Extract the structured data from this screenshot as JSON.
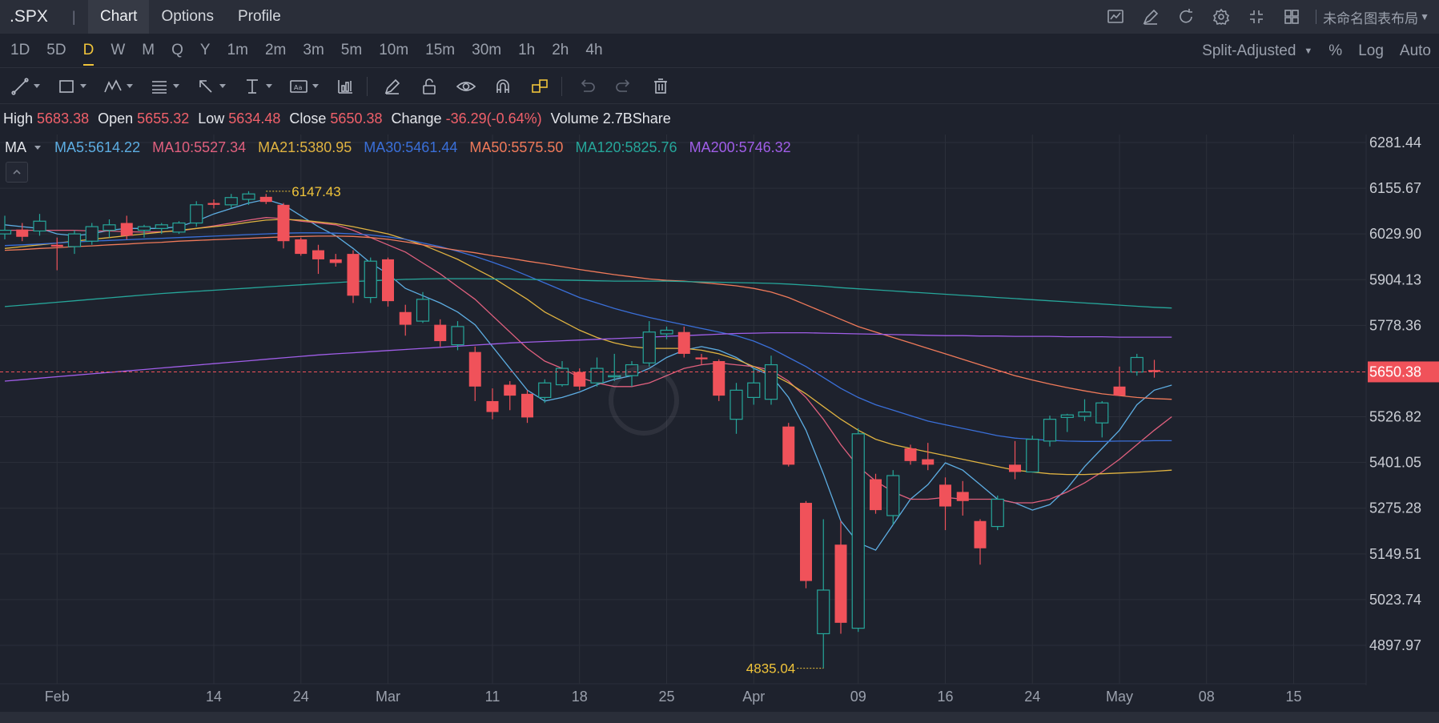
{
  "topbar": {
    "symbol": ".SPX",
    "tabs": [
      {
        "label": "Chart",
        "active": true
      },
      {
        "label": "Options",
        "active": false
      },
      {
        "label": "Profile",
        "active": false
      }
    ],
    "icons": [
      "chart-icon",
      "draw-icon",
      "refresh-icon",
      "settings-icon",
      "fullscreen-icon",
      "layout-grid-icon"
    ],
    "layout_name": "未命名图表布局"
  },
  "intervals": [
    {
      "label": "1D",
      "active": false
    },
    {
      "label": "5D",
      "active": false
    },
    {
      "label": "D",
      "active": true
    },
    {
      "label": "W",
      "active": false
    },
    {
      "label": "M",
      "active": false
    },
    {
      "label": "Q",
      "active": false
    },
    {
      "label": "Y",
      "active": false
    },
    {
      "label": "1m",
      "active": false
    },
    {
      "label": "2m",
      "active": false
    },
    {
      "label": "3m",
      "active": false
    },
    {
      "label": "5m",
      "active": false
    },
    {
      "label": "10m",
      "active": false
    },
    {
      "label": "15m",
      "active": false
    },
    {
      "label": "30m",
      "active": false
    },
    {
      "label": "1h",
      "active": false
    },
    {
      "label": "2h",
      "active": false
    },
    {
      "label": "4h",
      "active": false
    }
  ],
  "interval_right": {
    "adjust": "Split-Adjusted",
    "percent": "%",
    "log": "Log",
    "auto": "Auto"
  },
  "toolbar": {
    "tools": [
      "trendline-icon",
      "rectangle-icon",
      "pattern-icon",
      "fibonacci-icon",
      "arrow-icon",
      "measure-icon",
      "text-icon",
      "indicator-icon"
    ],
    "actions": [
      "pencil-icon",
      "lock-icon",
      "eye-icon",
      "magnet-icon",
      "link-icon",
      "undo-icon",
      "redo-icon",
      "trash-icon"
    ]
  },
  "ohlc": {
    "high_label": "High",
    "high": "5683.38",
    "open_label": "Open",
    "open": "5655.32",
    "low_label": "Low",
    "low": "5634.48",
    "close_label": "Close",
    "close": "5650.38",
    "change_label": "Change",
    "change": "-36.29(-0.64%)",
    "volume_label": "Volume",
    "volume": "2.7BShare"
  },
  "ma_indicator": {
    "label": "MA",
    "items": [
      {
        "text": "MA5:5614.22",
        "color": "#5dade2"
      },
      {
        "text": "MA10:5527.34",
        "color": "#e0607e"
      },
      {
        "text": "MA21:5380.95",
        "color": "#e0b341"
      },
      {
        "text": "MA30:5461.44",
        "color": "#3a6fd8"
      },
      {
        "text": "MA50:5575.50",
        "color": "#f07a5a"
      },
      {
        "text": "MA120:5825.76",
        "color": "#26a69a"
      },
      {
        "text": "MA200:5746.32",
        "color": "#a05ee8"
      }
    ]
  },
  "chart_data": {
    "type": "candlestick",
    "y_ticks": [
      "6281.44",
      "6155.67",
      "6029.90",
      "5904.13",
      "5778.36",
      "5650.38",
      "5526.82",
      "5401.05",
      "5275.28",
      "5149.51",
      "5023.74",
      "4897.97"
    ],
    "ylim": [
      4835.04,
      6281.44
    ],
    "current_price": "5650.38",
    "x_ticks": [
      {
        "label": "Feb",
        "index": 3
      },
      {
        "label": "14",
        "index": 12
      },
      {
        "label": "24",
        "index": 17
      },
      {
        "label": "Mar",
        "index": 22
      },
      {
        "label": "11",
        "index": 28
      },
      {
        "label": "18",
        "index": 33
      },
      {
        "label": "25",
        "index": 38
      },
      {
        "label": "Apr",
        "index": 43
      },
      {
        "label": "09",
        "index": 49
      },
      {
        "label": "16",
        "index": 54
      },
      {
        "label": "24",
        "index": 59
      },
      {
        "label": "May",
        "index": 64
      },
      {
        "label": "08",
        "index": 69
      },
      {
        "label": "15",
        "index": 74
      }
    ],
    "annotations": [
      {
        "text": "6147.43",
        "index": 15,
        "value": 6147.43
      },
      {
        "text": "4835.04",
        "index": 47,
        "value": 4835.04
      }
    ],
    "candles": [
      {
        "o": 6030,
        "h": 6080,
        "l": 6015,
        "c": 6040
      },
      {
        "o": 6042,
        "h": 6060,
        "l": 6010,
        "c": 6022
      },
      {
        "o": 6038,
        "h": 6085,
        "l": 6025,
        "c": 6065
      },
      {
        "o": 6000,
        "h": 6020,
        "l": 5930,
        "c": 5995
      },
      {
        "o": 5995,
        "h": 6040,
        "l": 5975,
        "c": 6030
      },
      {
        "o": 6010,
        "h": 6060,
        "l": 6000,
        "c": 6050
      },
      {
        "o": 6040,
        "h": 6070,
        "l": 6020,
        "c": 6055
      },
      {
        "o": 6060,
        "h": 6080,
        "l": 6015,
        "c": 6025
      },
      {
        "o": 6040,
        "h": 6055,
        "l": 6020,
        "c": 6050
      },
      {
        "o": 6045,
        "h": 6060,
        "l": 6030,
        "c": 6055
      },
      {
        "o": 6035,
        "h": 6065,
        "l": 6030,
        "c": 6060
      },
      {
        "o": 6060,
        "h": 6120,
        "l": 6050,
        "c": 6110
      },
      {
        "o": 6115,
        "h": 6125,
        "l": 6100,
        "c": 6110
      },
      {
        "o": 6110,
        "h": 6140,
        "l": 6100,
        "c": 6130
      },
      {
        "o": 6125,
        "h": 6147.43,
        "l": 6110,
        "c": 6140
      },
      {
        "o": 6132,
        "h": 6140,
        "l": 6112,
        "c": 6118
      },
      {
        "o": 6110,
        "h": 6115,
        "l": 5990,
        "c": 6010
      },
      {
        "o": 6015,
        "h": 6020,
        "l": 5970,
        "c": 5975
      },
      {
        "o": 5985,
        "h": 6000,
        "l": 5920,
        "c": 5960
      },
      {
        "o": 5960,
        "h": 5975,
        "l": 5940,
        "c": 5950
      },
      {
        "o": 5975,
        "h": 5985,
        "l": 5840,
        "c": 5860
      },
      {
        "o": 5855,
        "h": 5965,
        "l": 5840,
        "c": 5955
      },
      {
        "o": 5960,
        "h": 5965,
        "l": 5830,
        "c": 5845
      },
      {
        "o": 5815,
        "h": 5835,
        "l": 5750,
        "c": 5780
      },
      {
        "o": 5790,
        "h": 5870,
        "l": 5785,
        "c": 5850
      },
      {
        "o": 5780,
        "h": 5795,
        "l": 5720,
        "c": 5735
      },
      {
        "o": 5725,
        "h": 5790,
        "l": 5710,
        "c": 5775
      },
      {
        "o": 5705,
        "h": 5720,
        "l": 5570,
        "c": 5610
      },
      {
        "o": 5570,
        "h": 5605,
        "l": 5520,
        "c": 5540
      },
      {
        "o": 5615,
        "h": 5625,
        "l": 5545,
        "c": 5585
      },
      {
        "o": 5590,
        "h": 5600,
        "l": 5510,
        "c": 5525
      },
      {
        "o": 5580,
        "h": 5630,
        "l": 5565,
        "c": 5620
      },
      {
        "o": 5615,
        "h": 5680,
        "l": 5610,
        "c": 5660
      },
      {
        "o": 5650,
        "h": 5660,
        "l": 5600,
        "c": 5610
      },
      {
        "o": 5620,
        "h": 5690,
        "l": 5610,
        "c": 5660
      },
      {
        "o": 5640,
        "h": 5700,
        "l": 5625,
        "c": 5640
      },
      {
        "o": 5640,
        "h": 5680,
        "l": 5610,
        "c": 5670
      },
      {
        "o": 5675,
        "h": 5790,
        "l": 5665,
        "c": 5760
      },
      {
        "o": 5755,
        "h": 5775,
        "l": 5740,
        "c": 5765
      },
      {
        "o": 5760,
        "h": 5775,
        "l": 5690,
        "c": 5700
      },
      {
        "o": 5690,
        "h": 5700,
        "l": 5670,
        "c": 5685
      },
      {
        "o": 5680,
        "h": 5685,
        "l": 5570,
        "c": 5585
      },
      {
        "o": 5520,
        "h": 5620,
        "l": 5480,
        "c": 5600
      },
      {
        "o": 5580,
        "h": 5660,
        "l": 5560,
        "c": 5620
      },
      {
        "o": 5575,
        "h": 5695,
        "l": 5560,
        "c": 5670
      },
      {
        "o": 5500,
        "h": 5510,
        "l": 5390,
        "c": 5395
      },
      {
        "o": 5290,
        "h": 5295,
        "l": 5055,
        "c": 5075
      },
      {
        "o": 4930,
        "h": 5245,
        "l": 4835.04,
        "c": 5050
      },
      {
        "o": 5175,
        "h": 5240,
        "l": 4930,
        "c": 4960
      },
      {
        "o": 4945,
        "h": 5495,
        "l": 4935,
        "c": 5480
      },
      {
        "o": 5355,
        "h": 5370,
        "l": 5260,
        "c": 5270
      },
      {
        "o": 5255,
        "h": 5380,
        "l": 5230,
        "c": 5365
      },
      {
        "o": 5440,
        "h": 5450,
        "l": 5395,
        "c": 5405
      },
      {
        "o": 5410,
        "h": 5455,
        "l": 5380,
        "c": 5395
      },
      {
        "o": 5340,
        "h": 5360,
        "l": 5215,
        "c": 5280
      },
      {
        "o": 5320,
        "h": 5350,
        "l": 5255,
        "c": 5295
      },
      {
        "o": 5240,
        "h": 5245,
        "l": 5120,
        "c": 5165
      },
      {
        "o": 5225,
        "h": 5310,
        "l": 5215,
        "c": 5300
      },
      {
        "o": 5395,
        "h": 5460,
        "l": 5355,
        "c": 5375
      },
      {
        "o": 5375,
        "h": 5475,
        "l": 5375,
        "c": 5465
      },
      {
        "o": 5460,
        "h": 5530,
        "l": 5445,
        "c": 5520
      },
      {
        "o": 5525,
        "h": 5535,
        "l": 5485,
        "c": 5532
      },
      {
        "o": 5528,
        "h": 5575,
        "l": 5515,
        "c": 5540
      },
      {
        "o": 5510,
        "h": 5570,
        "l": 5470,
        "c": 5565
      },
      {
        "o": 5610,
        "h": 5665,
        "l": 5590,
        "c": 5585
      },
      {
        "o": 5650,
        "h": 5700,
        "l": 5640,
        "c": 5690
      },
      {
        "o": 5655.32,
        "h": 5683.38,
        "l": 5634.48,
        "c": 5650.38
      }
    ],
    "ma_lines": [
      {
        "name": "MA5",
        "color": "#5dade2",
        "values": [
          6055,
          6050,
          6045,
          6030,
          6025,
          6030,
          6040,
          6045,
          6045,
          6045,
          6050,
          6065,
          6085,
          6100,
          6115,
          6125,
          6110,
          6080,
          6050,
          6025,
          5990,
          5950,
          5920,
          5880,
          5860,
          5840,
          5815,
          5780,
          5720,
          5660,
          5600,
          5570,
          5580,
          5595,
          5615,
          5630,
          5640,
          5660,
          5690,
          5710,
          5720,
          5710,
          5690,
          5660,
          5640,
          5580,
          5490,
          5370,
          5240,
          5180,
          5160,
          5230,
          5300,
          5340,
          5400,
          5380,
          5340,
          5300,
          5290,
          5270,
          5285,
          5330,
          5390,
          5440,
          5490,
          5560,
          5600,
          5614
        ]
      },
      {
        "name": "MA10",
        "color": "#e0607e",
        "values": [
          6040,
          6040,
          6040,
          6040,
          6040,
          6038,
          6038,
          6036,
          6035,
          6036,
          6038,
          6045,
          6052,
          6060,
          6068,
          6075,
          6072,
          6065,
          6060,
          6055,
          6040,
          6020,
          6000,
          5980,
          5950,
          5920,
          5885,
          5850,
          5805,
          5760,
          5715,
          5680,
          5660,
          5635,
          5620,
          5610,
          5610,
          5620,
          5640,
          5660,
          5670,
          5675,
          5670,
          5665,
          5655,
          5625,
          5580,
          5520,
          5450,
          5390,
          5350,
          5320,
          5300,
          5300,
          5305,
          5300,
          5300,
          5300,
          5290,
          5290,
          5300,
          5320,
          5345,
          5375,
          5410,
          5450,
          5490,
          5527
        ]
      },
      {
        "name": "MA21",
        "color": "#e0b341",
        "values": [
          5990,
          5995,
          6000,
          6005,
          6010,
          6015,
          6020,
          6025,
          6030,
          6035,
          6040,
          6045,
          6050,
          6055,
          6062,
          6068,
          6070,
          6068,
          6063,
          6058,
          6050,
          6040,
          6030,
          6015,
          6000,
          5980,
          5960,
          5935,
          5910,
          5880,
          5850,
          5815,
          5790,
          5765,
          5745,
          5730,
          5720,
          5715,
          5715,
          5715,
          5710,
          5700,
          5685,
          5665,
          5645,
          5620,
          5590,
          5555,
          5520,
          5490,
          5465,
          5450,
          5440,
          5430,
          5420,
          5410,
          5400,
          5390,
          5380,
          5375,
          5370,
          5368,
          5368,
          5370,
          5372,
          5374,
          5377,
          5380
        ]
      },
      {
        "name": "MA30",
        "color": "#3a6fd8",
        "values": [
          5998,
          6000,
          6002,
          6005,
          6008,
          6010,
          6012,
          6014,
          6016,
          6018,
          6020,
          6022,
          6024,
          6026,
          6028,
          6030,
          6032,
          6033,
          6033,
          6032,
          6030,
          6027,
          6022,
          6015,
          6005,
          5995,
          5982,
          5968,
          5952,
          5935,
          5915,
          5895,
          5875,
          5855,
          5840,
          5825,
          5812,
          5800,
          5790,
          5780,
          5770,
          5760,
          5750,
          5735,
          5715,
          5690,
          5665,
          5635,
          5605,
          5580,
          5560,
          5545,
          5530,
          5515,
          5505,
          5495,
          5485,
          5475,
          5468,
          5465,
          5462,
          5460,
          5459,
          5459,
          5460,
          5460,
          5461,
          5461
        ]
      },
      {
        "name": "MA50",
        "color": "#f07a5a",
        "values": [
          5985,
          5987,
          5990,
          5992,
          5995,
          5997,
          6000,
          6002,
          6005,
          6007,
          6010,
          6012,
          6014,
          6016,
          6018,
          6020,
          6022,
          6023,
          6024,
          6024,
          6023,
          6020,
          6015,
          6008,
          6000,
          5992,
          5985,
          5978,
          5970,
          5963,
          5955,
          5948,
          5940,
          5932,
          5925,
          5918,
          5912,
          5906,
          5902,
          5900,
          5896,
          5892,
          5887,
          5880,
          5870,
          5855,
          5835,
          5815,
          5795,
          5775,
          5760,
          5745,
          5730,
          5715,
          5700,
          5685,
          5670,
          5655,
          5640,
          5628,
          5617,
          5607,
          5598,
          5590,
          5585,
          5580,
          5577,
          5575
        ]
      },
      {
        "name": "MA120",
        "color": "#26a69a",
        "values": [
          5830,
          5834,
          5838,
          5842,
          5846,
          5850,
          5854,
          5858,
          5862,
          5866,
          5869,
          5872,
          5875,
          5878,
          5881,
          5884,
          5887,
          5890,
          5893,
          5896,
          5899,
          5901,
          5903,
          5905,
          5906,
          5907,
          5907,
          5907,
          5906,
          5906,
          5905,
          5904,
          5903,
          5902,
          5901,
          5900,
          5900,
          5900,
          5900,
          5899,
          5898,
          5897,
          5896,
          5895,
          5894,
          5892,
          5889,
          5886,
          5882,
          5879,
          5876,
          5873,
          5870,
          5867,
          5864,
          5861,
          5858,
          5855,
          5852,
          5849,
          5846,
          5843,
          5840,
          5837,
          5834,
          5831,
          5828,
          5826
        ]
      },
      {
        "name": "MA200",
        "color": "#a05ee8",
        "values": [
          5625,
          5629,
          5633,
          5637,
          5641,
          5645,
          5649,
          5653,
          5657,
          5661,
          5665,
          5669,
          5673,
          5677,
          5681,
          5685,
          5689,
          5693,
          5697,
          5700,
          5703,
          5706,
          5709,
          5712,
          5715,
          5718,
          5721,
          5724,
          5727,
          5730,
          5732,
          5734,
          5736,
          5738,
          5740,
          5742,
          5744,
          5746,
          5748,
          5750,
          5752,
          5754,
          5756,
          5757,
          5758,
          5758,
          5758,
          5757,
          5756,
          5755,
          5754,
          5753,
          5752,
          5751,
          5750,
          5750,
          5749,
          5749,
          5748,
          5748,
          5748,
          5747,
          5747,
          5747,
          5746,
          5746,
          5746,
          5746
        ]
      }
    ]
  }
}
